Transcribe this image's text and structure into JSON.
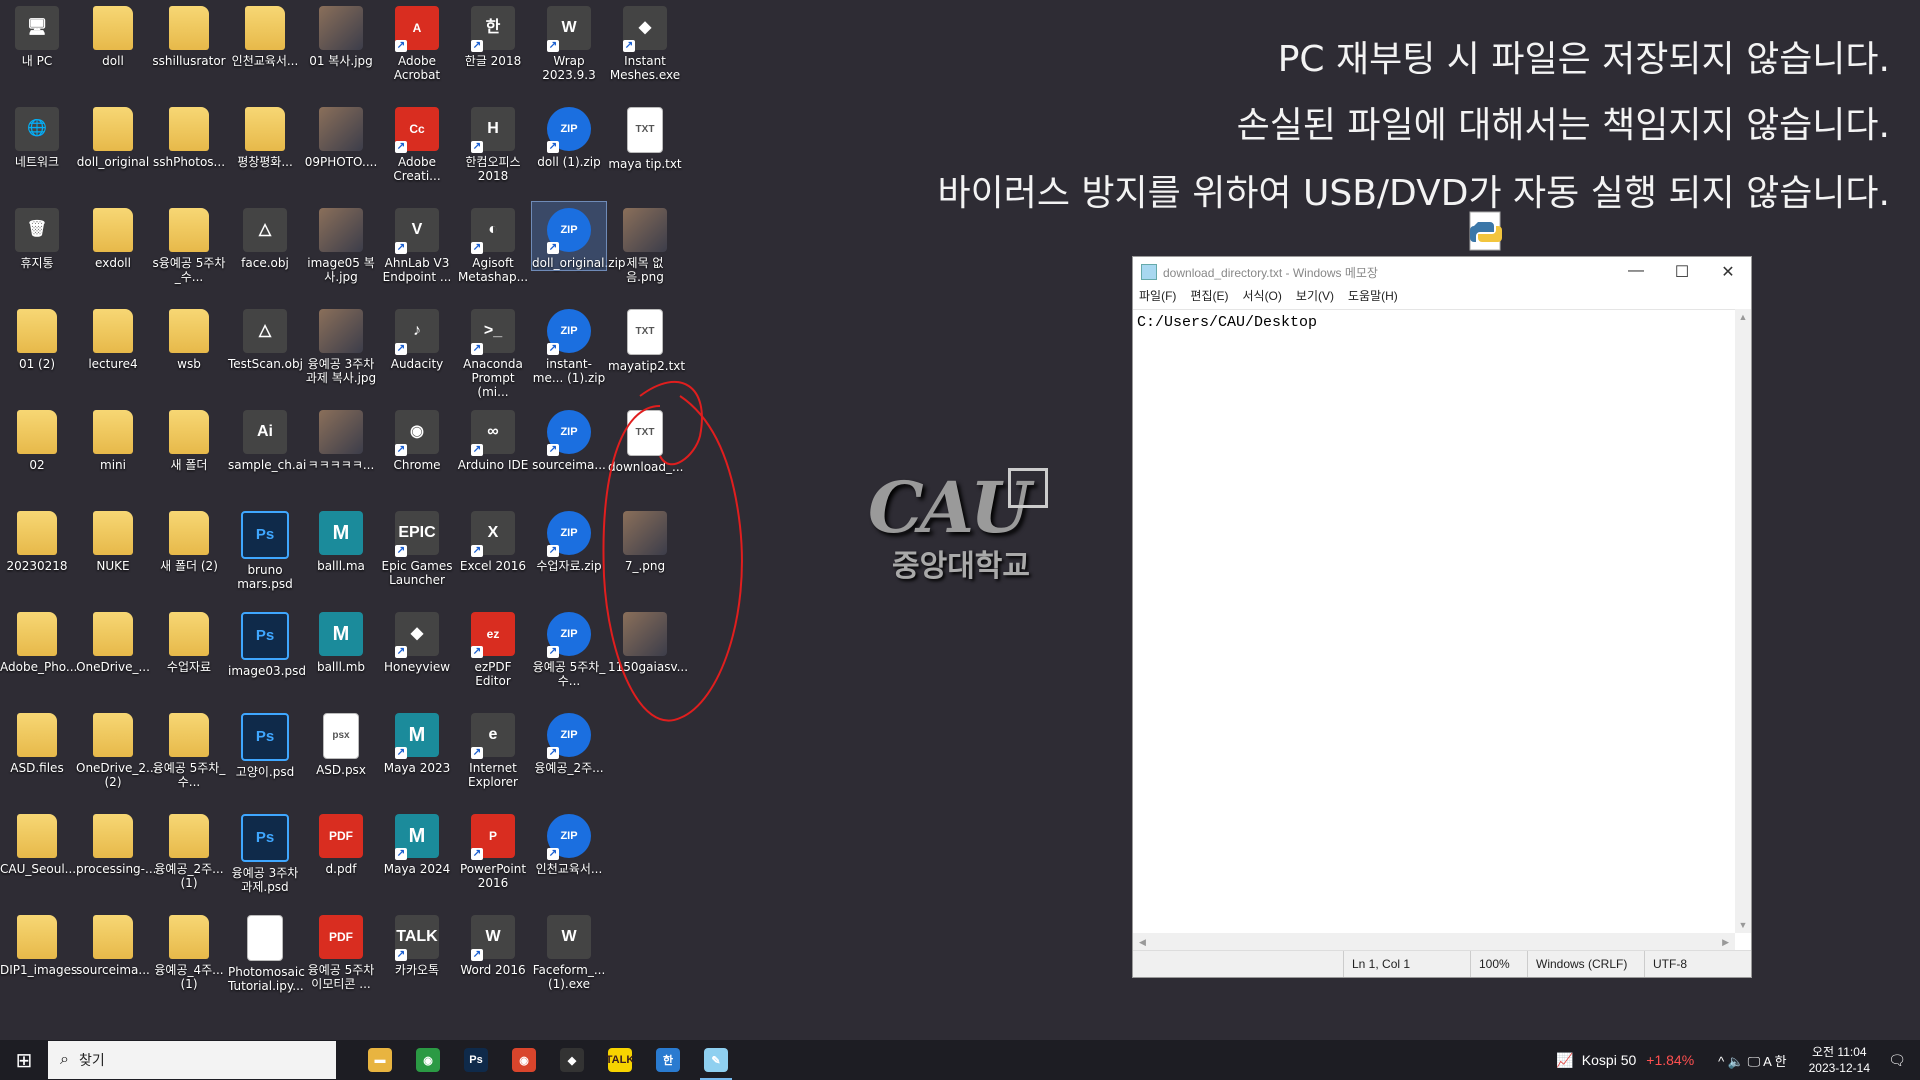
{
  "desktop": {
    "icons": [
      {
        "label": "내 PC",
        "type": "app",
        "glyph": "🖥",
        "col": 0,
        "row": 0
      },
      {
        "label": "doll",
        "type": "folder",
        "glyph": "",
        "col": 1,
        "row": 0
      },
      {
        "label": "sshillusrator",
        "type": "folder",
        "glyph": "",
        "col": 2,
        "row": 0
      },
      {
        "label": "인천교육서...",
        "type": "folder",
        "glyph": "",
        "col": 3,
        "row": 0
      },
      {
        "label": "01 복사.jpg",
        "type": "img",
        "glyph": "",
        "col": 4,
        "row": 0
      },
      {
        "label": "Adobe Acrobat",
        "type": "pdf",
        "glyph": "A",
        "col": 5,
        "row": 0,
        "shortcut": true
      },
      {
        "label": "한글 2018",
        "type": "app",
        "glyph": "한",
        "col": 6,
        "row": 0,
        "shortcut": true
      },
      {
        "label": "Wrap 2023.9.3",
        "type": "app",
        "glyph": "W",
        "col": 7,
        "row": 0,
        "shortcut": true
      },
      {
        "label": "Instant Meshes.exe",
        "type": "app",
        "glyph": "◆",
        "col": 8,
        "row": 0,
        "shortcut": true
      },
      {
        "label": "네트워크",
        "type": "app",
        "glyph": "🌐",
        "col": 0,
        "row": 1
      },
      {
        "label": "doll_original",
        "type": "folder",
        "glyph": "",
        "col": 1,
        "row": 1
      },
      {
        "label": "sshPhotos...",
        "type": "folder",
        "glyph": "",
        "col": 2,
        "row": 1
      },
      {
        "label": "평창평화...",
        "type": "folder",
        "glyph": "",
        "col": 3,
        "row": 1
      },
      {
        "label": "09PHOTO....",
        "type": "img",
        "glyph": "",
        "col": 4,
        "row": 1
      },
      {
        "label": "Adobe Creati...",
        "type": "pdf",
        "glyph": "Cc",
        "col": 5,
        "row": 1,
        "shortcut": true
      },
      {
        "label": "한컴오피스 2018",
        "type": "app",
        "glyph": "H",
        "col": 6,
        "row": 1,
        "shortcut": true
      },
      {
        "label": "doll (1).zip",
        "type": "zip",
        "glyph": "ZIP",
        "col": 7,
        "row": 1,
        "shortcut": true
      },
      {
        "label": "maya tip.txt",
        "type": "txt",
        "glyph": "TXT",
        "col": 8,
        "row": 1
      },
      {
        "label": "휴지통",
        "type": "app",
        "glyph": "🗑",
        "col": 0,
        "row": 2
      },
      {
        "label": "exdoll",
        "type": "folder",
        "glyph": "",
        "col": 1,
        "row": 2
      },
      {
        "label": "s융예공 5주차_수...",
        "type": "folder",
        "glyph": "",
        "col": 2,
        "row": 2
      },
      {
        "label": "face.obj",
        "type": "app",
        "glyph": "△",
        "col": 3,
        "row": 2
      },
      {
        "label": "image05 복사.jpg",
        "type": "img",
        "glyph": "",
        "col": 4,
        "row": 2
      },
      {
        "label": "AhnLab V3 Endpoint ...",
        "type": "app",
        "glyph": "V",
        "col": 5,
        "row": 2,
        "shortcut": true
      },
      {
        "label": "Agisoft Metashap...",
        "type": "app",
        "glyph": "◐",
        "col": 6,
        "row": 2,
        "shortcut": true
      },
      {
        "label": "doll_original.zip",
        "type": "zip",
        "glyph": "ZIP",
        "col": 7,
        "row": 2,
        "shortcut": true,
        "selected": true
      },
      {
        "label": "제목 없음.png",
        "type": "img",
        "glyph": "",
        "col": 8,
        "row": 2
      },
      {
        "label": "01 (2)",
        "type": "folder",
        "glyph": "",
        "col": 0,
        "row": 3
      },
      {
        "label": "lecture4",
        "type": "folder",
        "glyph": "",
        "col": 1,
        "row": 3
      },
      {
        "label": "wsb",
        "type": "folder",
        "glyph": "",
        "col": 2,
        "row": 3
      },
      {
        "label": "TestScan.obj",
        "type": "app",
        "glyph": "△",
        "col": 3,
        "row": 3
      },
      {
        "label": "융예공 3주차 과제 복사.jpg",
        "type": "img",
        "glyph": "",
        "col": 4,
        "row": 3
      },
      {
        "label": "Audacity",
        "type": "app",
        "glyph": "♪",
        "col": 5,
        "row": 3,
        "shortcut": true
      },
      {
        "label": "Anaconda Prompt (mi...",
        "type": "app",
        "glyph": ">_",
        "col": 6,
        "row": 3,
        "shortcut": true
      },
      {
        "label": "instant-me... (1).zip",
        "type": "zip",
        "glyph": "ZIP",
        "col": 7,
        "row": 3,
        "shortcut": true
      },
      {
        "label": "mayatip2.txt",
        "type": "txt",
        "glyph": "TXT",
        "col": 8,
        "row": 3
      },
      {
        "label": "02",
        "type": "folder",
        "glyph": "",
        "col": 0,
        "row": 4
      },
      {
        "label": "mini",
        "type": "folder",
        "glyph": "",
        "col": 1,
        "row": 4
      },
      {
        "label": "새 폴더",
        "type": "folder",
        "glyph": "",
        "col": 2,
        "row": 4
      },
      {
        "label": "sample_ch.ai",
        "type": "app",
        "glyph": "Ai",
        "col": 3,
        "row": 4
      },
      {
        "label": "ㅋㅋㅋㅋㅋ...",
        "type": "img",
        "glyph": "",
        "col": 4,
        "row": 4
      },
      {
        "label": "Chrome",
        "type": "app",
        "glyph": "◉",
        "col": 5,
        "row": 4,
        "shortcut": true
      },
      {
        "label": "Arduino IDE",
        "type": "app",
        "glyph": "∞",
        "col": 6,
        "row": 4,
        "shortcut": true
      },
      {
        "label": "sourceima...",
        "type": "zip",
        "glyph": "ZIP",
        "col": 7,
        "row": 4,
        "shortcut": true
      },
      {
        "label": "download_...",
        "type": "txt",
        "glyph": "TXT",
        "col": 8,
        "row": 4
      },
      {
        "label": "20230218",
        "type": "folder",
        "glyph": "",
        "col": 0,
        "row": 5
      },
      {
        "label": "NUKE",
        "type": "folder",
        "glyph": "",
        "col": 1,
        "row": 5
      },
      {
        "label": "새 폴더 (2)",
        "type": "folder",
        "glyph": "",
        "col": 2,
        "row": 5
      },
      {
        "label": "bruno mars.psd",
        "type": "ps",
        "glyph": "Ps",
        "col": 3,
        "row": 5
      },
      {
        "label": "balll.ma",
        "type": "maya",
        "glyph": "M",
        "col": 4,
        "row": 5
      },
      {
        "label": "Epic Games Launcher",
        "type": "app",
        "glyph": "EPIC",
        "col": 5,
        "row": 5,
        "shortcut": true
      },
      {
        "label": "Excel 2016",
        "type": "app",
        "glyph": "X",
        "col": 6,
        "row": 5,
        "shortcut": true
      },
      {
        "label": "수업자료.zip",
        "type": "zip",
        "glyph": "ZIP",
        "col": 7,
        "row": 5,
        "shortcut": true
      },
      {
        "label": "7_.png",
        "type": "img",
        "glyph": "",
        "col": 8,
        "row": 5
      },
      {
        "label": "Adobe_Pho...",
        "type": "folder",
        "glyph": "",
        "col": 0,
        "row": 6
      },
      {
        "label": "OneDrive_...",
        "type": "folder",
        "glyph": "",
        "col": 1,
        "row": 6
      },
      {
        "label": "수업자료",
        "type": "folder",
        "glyph": "",
        "col": 2,
        "row": 6
      },
      {
        "label": "image03.psd",
        "type": "ps",
        "glyph": "Ps",
        "col": 3,
        "row": 6
      },
      {
        "label": "balll.mb",
        "type": "maya",
        "glyph": "M",
        "col": 4,
        "row": 6
      },
      {
        "label": "Honeyview",
        "type": "app",
        "glyph": "◆",
        "col": 5,
        "row": 6,
        "shortcut": true
      },
      {
        "label": "ezPDF Editor",
        "type": "pdf",
        "glyph": "ez",
        "col": 6,
        "row": 6,
        "shortcut": true
      },
      {
        "label": "융예공 5주차_수...",
        "type": "zip",
        "glyph": "ZIP",
        "col": 7,
        "row": 6,
        "shortcut": true
      },
      {
        "label": "1150gaiasv...",
        "type": "img",
        "glyph": "",
        "col": 8,
        "row": 6
      },
      {
        "label": "ASD.files",
        "type": "folder",
        "glyph": "",
        "col": 0,
        "row": 7
      },
      {
        "label": "OneDrive_2... (2)",
        "type": "folder",
        "glyph": "",
        "col": 1,
        "row": 7
      },
      {
        "label": "융예공 5주차_수...",
        "type": "folder",
        "glyph": "",
        "col": 2,
        "row": 7
      },
      {
        "label": "고양이.psd",
        "type": "ps",
        "glyph": "Ps",
        "col": 3,
        "row": 7
      },
      {
        "label": "ASD.psx",
        "type": "txt",
        "glyph": "psx",
        "col": 4,
        "row": 7
      },
      {
        "label": "Maya 2023",
        "type": "maya",
        "glyph": "M",
        "col": 5,
        "row": 7,
        "shortcut": true
      },
      {
        "label": "Internet Explorer",
        "type": "app",
        "glyph": "e",
        "col": 6,
        "row": 7,
        "shortcut": true
      },
      {
        "label": "융예공_2주...",
        "type": "zip",
        "glyph": "ZIP",
        "col": 7,
        "row": 7,
        "shortcut": true
      },
      {
        "label": "CAU_Seoul...",
        "type": "folder",
        "glyph": "",
        "col": 0,
        "row": 8
      },
      {
        "label": "processing-...",
        "type": "folder",
        "glyph": "",
        "col": 1,
        "row": 8
      },
      {
        "label": "융예공_2주... (1)",
        "type": "folder",
        "glyph": "",
        "col": 2,
        "row": 8
      },
      {
        "label": "융예공 3주차 과제.psd",
        "type": "ps",
        "glyph": "Ps",
        "col": 3,
        "row": 8
      },
      {
        "label": "d.pdf",
        "type": "pdf",
        "glyph": "PDF",
        "col": 4,
        "row": 8
      },
      {
        "label": "Maya 2024",
        "type": "maya",
        "glyph": "M",
        "col": 5,
        "row": 8,
        "shortcut": true
      },
      {
        "label": "PowerPoint 2016",
        "type": "pdf",
        "glyph": "P",
        "col": 6,
        "row": 8,
        "shortcut": true
      },
      {
        "label": "인천교육서...",
        "type": "zip",
        "glyph": "ZIP",
        "col": 7,
        "row": 8,
        "shortcut": true
      },
      {
        "label": "DIP1_images",
        "type": "folder",
        "glyph": "",
        "col": 0,
        "row": 9
      },
      {
        "label": "sourceima...",
        "type": "folder",
        "glyph": "",
        "col": 1,
        "row": 9
      },
      {
        "label": "융예공_4주... (1)",
        "type": "folder",
        "glyph": "",
        "col": 2,
        "row": 9
      },
      {
        "label": "Photomosaic Tutorial.ipy...",
        "type": "txt",
        "glyph": "",
        "col": 3,
        "row": 9
      },
      {
        "label": "융예공 5주차 이모티콘 ...",
        "type": "pdf",
        "glyph": "PDF",
        "col": 4,
        "row": 9
      },
      {
        "label": "카카오톡",
        "type": "app",
        "glyph": "TALK",
        "col": 5,
        "row": 9,
        "shortcut": true
      },
      {
        "label": "Word 2016",
        "type": "app",
        "glyph": "W",
        "col": 6,
        "row": 9,
        "shortcut": true
      },
      {
        "label": "Faceform_... (1).exe",
        "type": "app",
        "glyph": "W",
        "col": 7,
        "row": 9
      }
    ]
  },
  "notice": {
    "line1": "PC 재부팅 시 파일은 저장되지 않습니다.",
    "line2": "손실된 파일에 대해서는 책임지지 않습니다.",
    "line3": "바이러스 방지를 위하여 USB/DVD가 자동 실행 되지 않습니다."
  },
  "logo": {
    "wordmark": "CAU",
    "name": "중앙대학교"
  },
  "notepad": {
    "title": "download_directory.txt - Windows 메모장",
    "controls": {
      "minimize": "—",
      "maximize": "☐",
      "close": "✕"
    },
    "menu": [
      "파일(F)",
      "편집(E)",
      "서식(O)",
      "보기(V)",
      "도움말(H)"
    ],
    "content": "C:/Users/CAU/Desktop",
    "status": {
      "position": "Ln 1, Col 1",
      "zoom": "100%",
      "line_ending": "Windows (CRLF)",
      "encoding": "UTF-8"
    }
  },
  "taskbar": {
    "start_icon": "⊞",
    "search_placeholder": "찾기",
    "apps": [
      {
        "name": "file-explorer",
        "glyph": "▬",
        "bg": "#e8b440"
      },
      {
        "name": "chrome",
        "glyph": "◉",
        "bg": "#2b9a44"
      },
      {
        "name": "photoshop",
        "glyph": "Ps",
        "bg": "#0f2a4a"
      },
      {
        "name": "chrome-2",
        "glyph": "◉",
        "bg": "#d9452c"
      },
      {
        "name": "honeyview",
        "glyph": "◆",
        "bg": "#333"
      },
      {
        "name": "kakaotalk",
        "glyph": "TALK",
        "bg": "#f7d400"
      },
      {
        "name": "hangul",
        "glyph": "한",
        "bg": "#2a7bd0"
      },
      {
        "name": "notepad",
        "glyph": "✎",
        "bg": "#8fd0f0",
        "active": true
      }
    ],
    "kospi": {
      "label": "Kospi 50",
      "change": "+1.84%"
    },
    "tray_icons": "^  🔈  🖵  A  한",
    "clock": {
      "time": "오전 11:04",
      "date": "2023-12-14"
    },
    "notifications": "🗨"
  },
  "colors": {
    "desktop_bg": "#2e2c34",
    "annotation": "#e01e1e",
    "kospi_change": "#ff5050"
  }
}
